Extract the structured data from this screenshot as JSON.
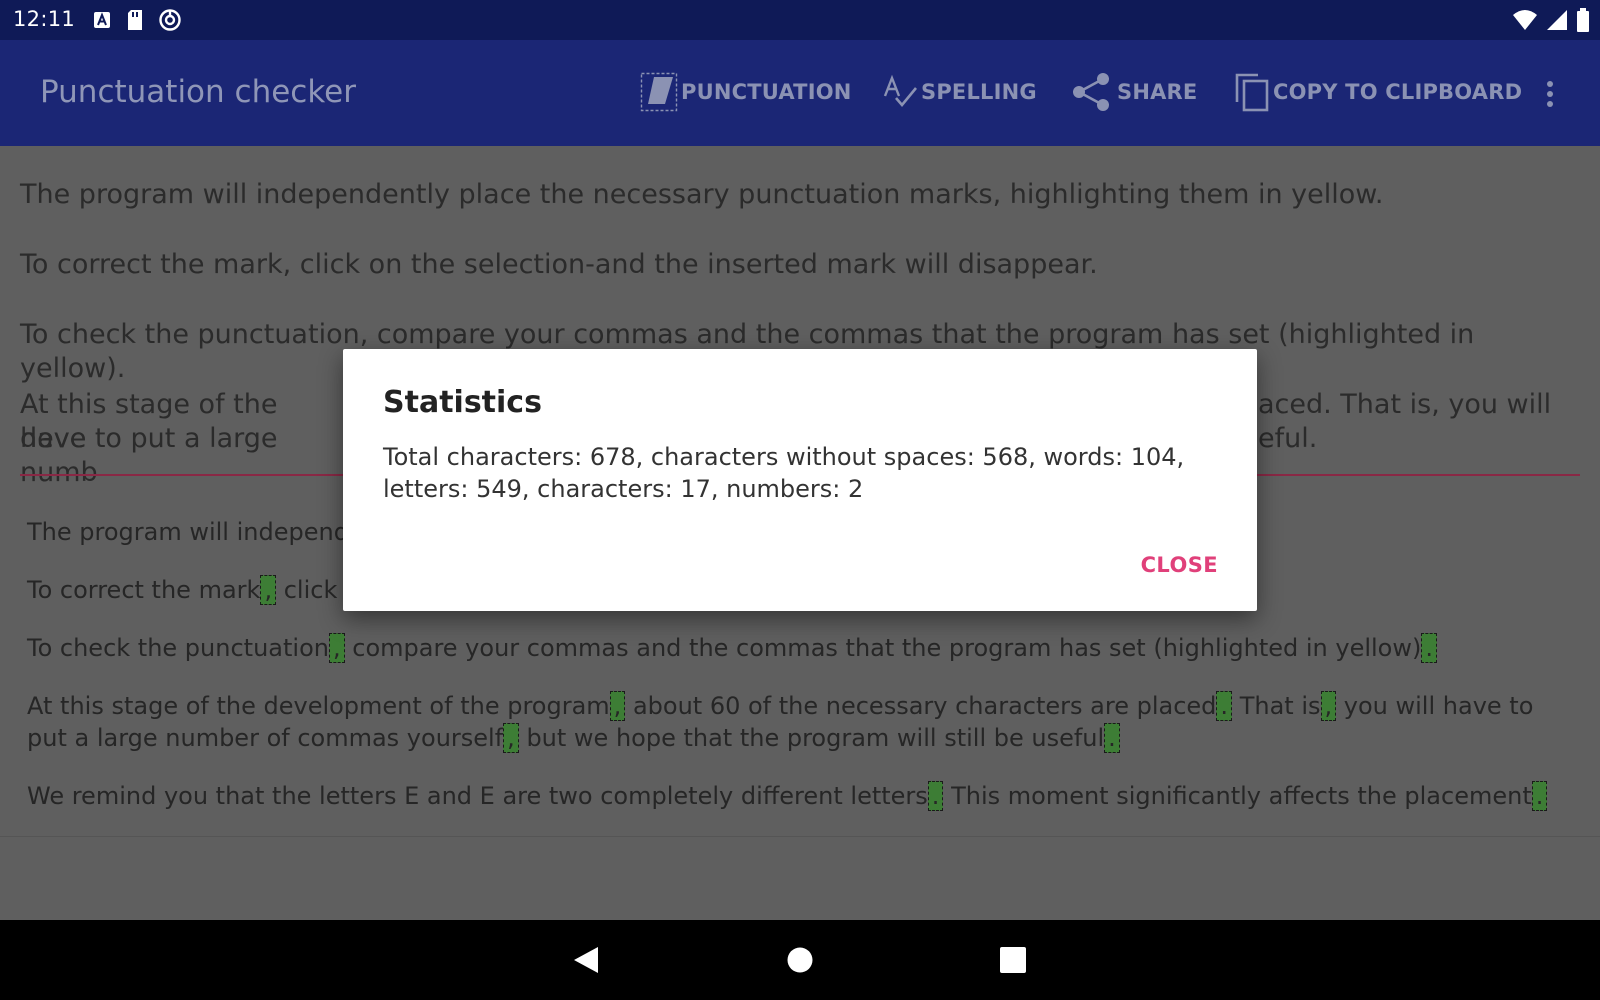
{
  "status_bar": {
    "time": "12:11",
    "left_icons": [
      "text-a-notification-icon",
      "sd-card-icon",
      "sync-icon"
    ],
    "right_icons": [
      "wifi-icon",
      "cellular-signal-icon",
      "battery-icon"
    ]
  },
  "app_bar": {
    "title": "Punctuation checker",
    "actions": [
      {
        "label": "PUNCTUATION",
        "icon": "punctuation-icon"
      },
      {
        "label": "SPELLING",
        "icon": "spelling-check-icon"
      },
      {
        "label": "SHARE",
        "icon": "share-icon"
      },
      {
        "label": "COPY TO CLIPBOARD",
        "icon": "copy-icon"
      }
    ],
    "overflow_icon": "more-vertical-icon"
  },
  "input_text": {
    "paragraphs": [
      "The program will independently place the necessary punctuation marks, highlighting them in yellow.",
      "To correct the mark, click on the selection-and the inserted mark will disappear.",
      "To check the punctuation, compare your commas and the commas that the program has set (highlighted in yellow).",
      "At this stage of the deve",
      "aced. That is, you will",
      "have to put a large numb",
      "eful."
    ]
  },
  "result_text": {
    "p1": "The program will independe",
    "p2_a": "To correct the mark",
    "p2_b": "click",
    "p3_a": "To check the punctuation",
    "p3_b": "compare your commas and the commas that the program has set (highlighted in yellow)",
    "p4_a": "At this stage of the development of the program",
    "p4_b": "about 60 of the necessary characters are placed",
    "p4_c": "That is",
    "p4_d": "you will have to put a large number of commas yourself",
    "p4_e": "but we hope that the program will still be useful",
    "p5_a": "We remind you that the letters E and E are two completely different letters",
    "p5_b": "This moment significantly affects the placement",
    "comma": ",",
    "period": "."
  },
  "dialog": {
    "title": "Statistics",
    "body": "Total characters: 678, characters without spaces: 568, words: 104, letters: 549, characters: 17, numbers: 2",
    "close_label": "CLOSE"
  },
  "nav_bar": {
    "icons": [
      "back-icon",
      "home-icon",
      "recents-icon"
    ]
  },
  "colors": {
    "status_bar": "#0f1a57",
    "app_bar": "#1b2675",
    "highlight": "#3d7d35",
    "divider": "#8a2845",
    "accent": "#e0407a"
  }
}
